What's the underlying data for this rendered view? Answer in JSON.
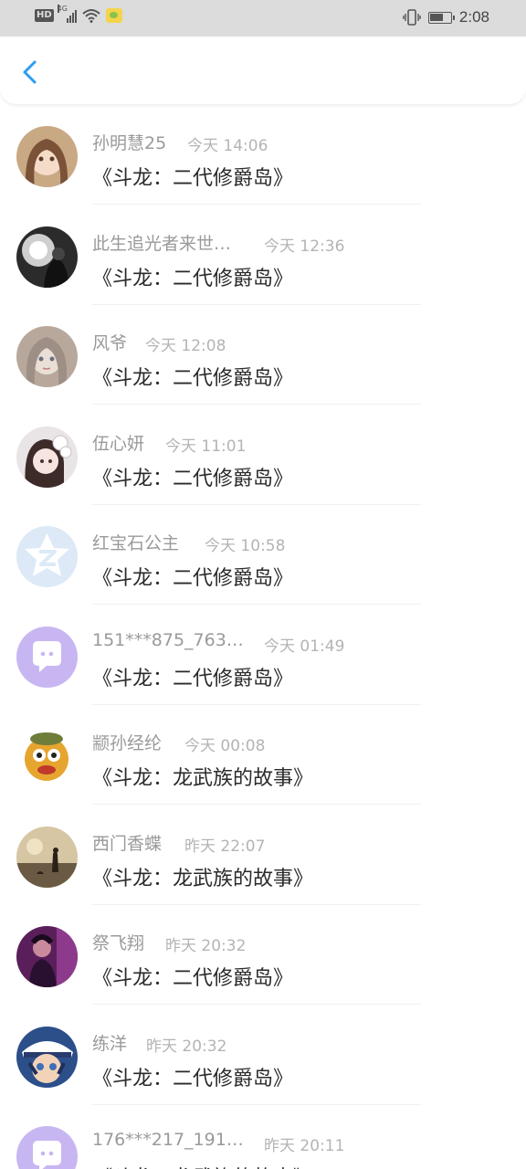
{
  "status_bar": {
    "network_badge": "HD",
    "signal_type": "4G",
    "time": "2:08",
    "icons": [
      "hd-badge",
      "signal-4g-icon",
      "wifi-icon",
      "wechat-notification-icon",
      "vibrate-icon",
      "battery-icon"
    ]
  },
  "header": {
    "back_icon": "chevron-left-icon",
    "accent": "#2a9df4"
  },
  "list": [
    {
      "name": "孙明慧25",
      "time": "今天 14:06",
      "title": "《斗龙：二代修爵岛》",
      "avatar": "anime-girl-avatar"
    },
    {
      "name": "此生追光者来世…",
      "time": "今天 12:36",
      "title": "《斗龙：二代修爵岛》",
      "avatar": "dark-fantasy-avatar"
    },
    {
      "name": "风爷",
      "time": "今天 12:08",
      "title": "《斗龙：二代修爵岛》",
      "avatar": "painted-girl-avatar"
    },
    {
      "name": "伍心妍",
      "time": "今天 11:01",
      "title": "《斗龙：二代修爵岛》",
      "avatar": "flower-girl-avatar"
    },
    {
      "name": "红宝石公主",
      "time": "今天 10:58",
      "title": "《斗龙：二代修爵岛》",
      "avatar": "qzone-default-avatar"
    },
    {
      "name": "151***875_763…",
      "time": "今天 01:49",
      "title": "《斗龙：二代修爵岛》",
      "avatar": "chat-bubble-default-avatar"
    },
    {
      "name": "颛孙经纶",
      "time": "今天 00:08",
      "title": "《斗龙：龙武族的故事》",
      "avatar": "cartoon-character-avatar"
    },
    {
      "name": "西门香蝶",
      "time": "昨天 22:07",
      "title": "《斗龙：龙武族的故事》",
      "avatar": "sunset-silhouette-avatar"
    },
    {
      "name": "祭飞翔",
      "time": "昨天 20:32",
      "title": "《斗龙：二代修爵岛》",
      "avatar": "purple-portrait-avatar"
    },
    {
      "name": "练洋",
      "time": "昨天 20:32",
      "title": "《斗龙：二代修爵岛》",
      "avatar": "anime-boy-avatar"
    },
    {
      "name": "176***217_191…",
      "time": "昨天 20:11",
      "title": "《斗龙：龙武族的故事》",
      "avatar": "chat-bubble-default-avatar"
    }
  ]
}
